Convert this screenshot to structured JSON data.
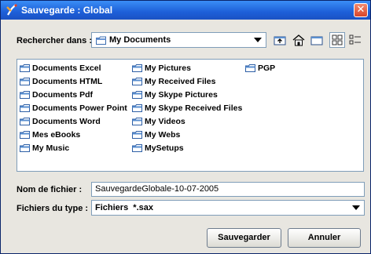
{
  "window": {
    "title": "Sauvegarde : Global",
    "close_symbol": "✕"
  },
  "lookin": {
    "label": "Rechercher dans :",
    "value": "My Documents"
  },
  "toolbar": {
    "buttons": [
      {
        "name": "up-folder-icon"
      },
      {
        "name": "home-icon"
      },
      {
        "name": "new-folder-icon"
      },
      {
        "name": "list-view-icon",
        "active": true
      },
      {
        "name": "details-view-icon"
      }
    ]
  },
  "files": [
    {
      "label": "Documents Excel"
    },
    {
      "label": "Documents HTML"
    },
    {
      "label": "Documents Pdf"
    },
    {
      "label": "Documents Power Point"
    },
    {
      "label": "Documents Word"
    },
    {
      "label": "Mes eBooks"
    },
    {
      "label": "My Music"
    },
    {
      "label": "My Pictures"
    },
    {
      "label": "My Received Files"
    },
    {
      "label": "My Skype Pictures"
    },
    {
      "label": "My Skype Received Files"
    },
    {
      "label": "My Videos"
    },
    {
      "label": "My Webs"
    },
    {
      "label": "MySetups"
    },
    {
      "label": "PGP"
    }
  ],
  "filename": {
    "label": "Nom de fichier :",
    "value": "SauvegardeGlobale-10-07-2005"
  },
  "filetype": {
    "label": "Fichiers du type :",
    "value": "Fichiers  *.sax"
  },
  "buttons": {
    "save": "Sauvegarder",
    "cancel": "Annuler"
  },
  "colors": {
    "titlebar": "#1d5fd8",
    "folder": "#5a8fd0",
    "dialog_bg": "#e8e6e0"
  }
}
